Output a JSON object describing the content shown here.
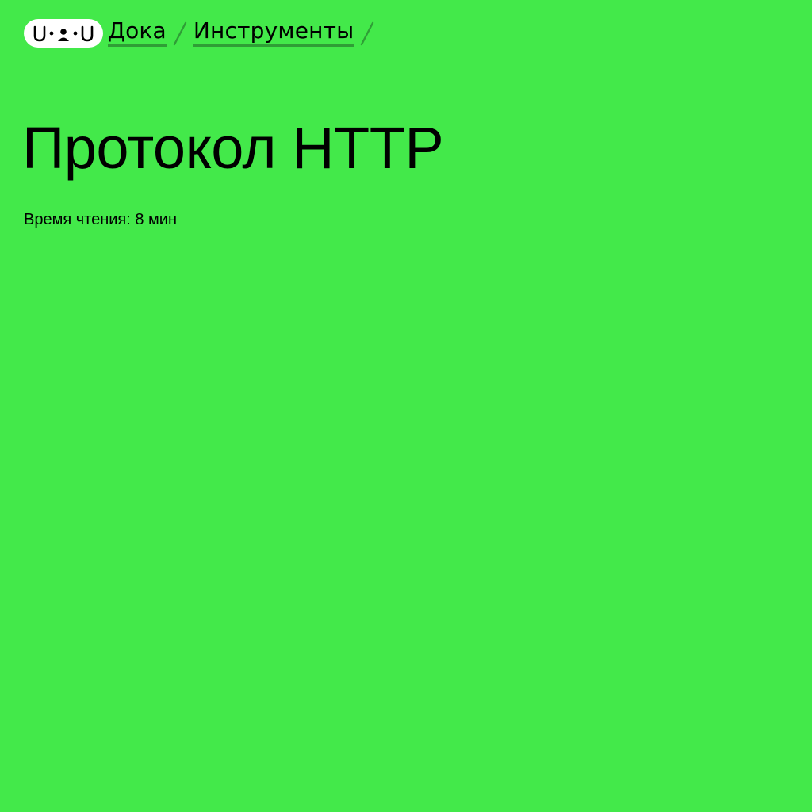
{
  "header": {
    "logo": {
      "icon": "uku-face-logo-icon"
    },
    "breadcrumb": [
      {
        "label": "Дока"
      },
      {
        "label": "Инструменты"
      }
    ],
    "separator_icon": "slash-icon"
  },
  "article": {
    "title": "Протокол HTTP",
    "reading_time": "Время чтения: 8 мин"
  },
  "colors": {
    "background": "#43e94a",
    "link_underline": "#2f9e36",
    "separator": "#2f9e36",
    "logo_background": "#ffffff",
    "text": "#000000"
  }
}
